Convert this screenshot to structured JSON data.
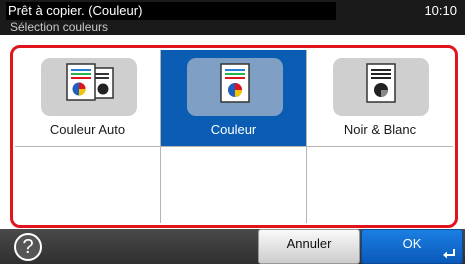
{
  "status": {
    "title": "Prêt à copier. (Couleur)",
    "time": "10:10"
  },
  "subtitle": "Sélection couleurs",
  "options": [
    {
      "label": "Couleur Auto",
      "icon": "auto-color-document-icon",
      "selected": false
    },
    {
      "label": "Couleur",
      "icon": "color-document-icon",
      "selected": true
    },
    {
      "label": "Noir & Blanc",
      "icon": "black-white-document-icon",
      "selected": false
    }
  ],
  "footer": {
    "help": "?",
    "cancel": "Annuler",
    "ok": "OK"
  },
  "colors": {
    "accent": "#0a5db2",
    "highlight_border": "#e0141c",
    "topbar": "#1a1a1a"
  }
}
